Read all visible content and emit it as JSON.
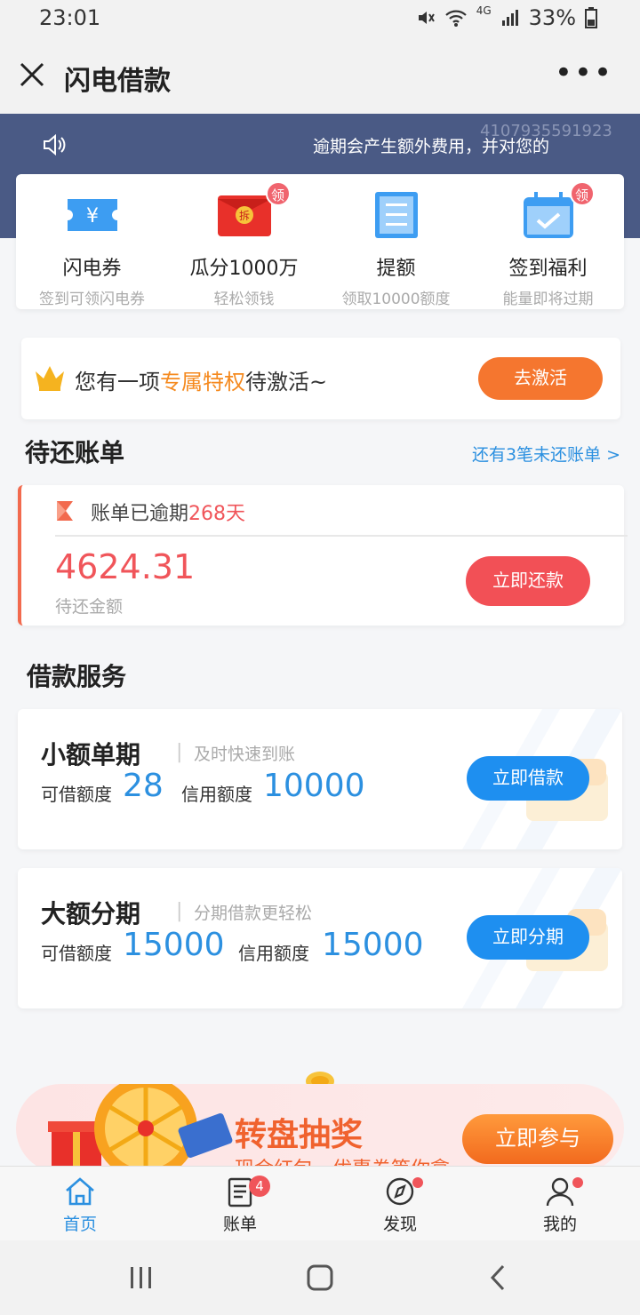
{
  "status_bar": {
    "time": "23:01",
    "battery": "33%",
    "network": "4G"
  },
  "nav": {
    "title": "闪电借款",
    "more": "•••"
  },
  "header": {
    "notice": "逾期会产生额外费用，并对您的",
    "id_number": "4107935591923"
  },
  "quick_entries": [
    {
      "label": "闪电券",
      "sub": "签到可领闪电券",
      "icon": "ticket-icon",
      "badge": ""
    },
    {
      "label": "瓜分1000万",
      "sub": "轻松领钱",
      "icon": "red-envelope-icon",
      "badge": "领"
    },
    {
      "label": "提额",
      "sub": "领取10000额度",
      "icon": "document-icon",
      "badge": ""
    },
    {
      "label": "签到福利",
      "sub": "能量即将过期",
      "icon": "calendar-check-icon",
      "badge": "领"
    }
  ],
  "privilege": {
    "prefix": "您有一项",
    "highlight": "专属特权",
    "suffix": "待激活~",
    "button": "去激活"
  },
  "bills_section": {
    "title": "待还账单",
    "link": "还有3笔未还账单 >"
  },
  "bill": {
    "status_prefix": "账单已逾期",
    "overdue_days": "268天",
    "amount": "4624.31",
    "amount_label": "待还金额",
    "button": "立即还款"
  },
  "loan_section": {
    "title": "借款服务"
  },
  "loans": [
    {
      "name": "小额单期",
      "sep": "|",
      "desc": "及时快速到账",
      "avail_label": "可借额度",
      "avail_value": "28",
      "credit_label": "信用额度",
      "credit_value": "10000",
      "button": "立即借款"
    },
    {
      "name": "大额分期",
      "sep": "|",
      "desc": "分期借款更轻松",
      "avail_label": "可借额度",
      "avail_value": "15000",
      "credit_label": "信用额度",
      "credit_value": "15000",
      "button": "立即分期"
    }
  ],
  "promo": {
    "title": "转盘抽奖",
    "sub": "现金红包、优惠券等你拿",
    "button": "立即参与"
  },
  "tabs": [
    {
      "label": "首页",
      "icon": "home-icon",
      "active": true,
      "badge": ""
    },
    {
      "label": "账单",
      "icon": "bill-icon",
      "active": false,
      "badge": "4"
    },
    {
      "label": "发现",
      "icon": "compass-icon",
      "active": false,
      "badge": "dot"
    },
    {
      "label": "我的",
      "icon": "user-icon",
      "active": false,
      "badge": "dot"
    }
  ],
  "colors": {
    "accent_blue": "#2c90e0",
    "header_bg": "#4a5a85",
    "overdue_red": "#f0555a",
    "orange": "#f58a1f"
  }
}
